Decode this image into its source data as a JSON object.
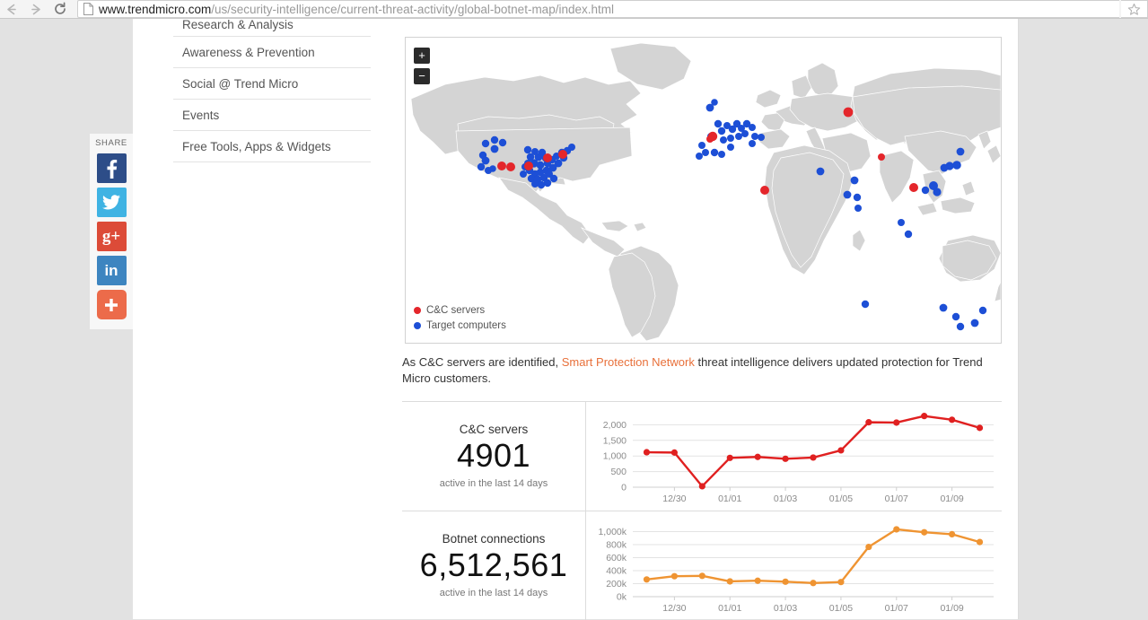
{
  "browser": {
    "back_icon": "back-arrow-icon",
    "forward_icon": "forward-arrow-icon",
    "reload_icon": "reload-icon",
    "page_icon": "page-document-icon",
    "star_icon": "bookmark-star-icon",
    "url_domain": "www.trendmicro.com",
    "url_path": "/us/security-intelligence/current-threat-activity/global-botnet-map/index.html"
  },
  "share": {
    "label": "SHARE",
    "items": [
      {
        "name": "facebook",
        "glyph": "f"
      },
      {
        "name": "twitter",
        "glyph": ""
      },
      {
        "name": "googleplus",
        "glyph": "g+"
      },
      {
        "name": "linkedin",
        "glyph": "in"
      },
      {
        "name": "addthis",
        "glyph": "+"
      }
    ]
  },
  "sidebar": {
    "items": [
      {
        "label": "Research & Analysis"
      },
      {
        "label": "Awareness & Prevention"
      },
      {
        "label": "Social @ Trend Micro"
      },
      {
        "label": "Events"
      },
      {
        "label": "Free Tools, Apps & Widgets"
      }
    ]
  },
  "map": {
    "zoom_in_label": "+",
    "zoom_out_label": "−",
    "legend": [
      {
        "label": "C&C servers",
        "color": "#e4262b"
      },
      {
        "label": "Target computers",
        "color": "#1d4fd6"
      }
    ]
  },
  "caption": {
    "before": "As C&C servers are identified, ",
    "link": "Smart Protection Network",
    "after": " threat intelligence delivers updated protection for Trend Micro customers."
  },
  "panels": [
    {
      "title": "C&C servers",
      "value": "4901",
      "subtitle": "active in the last 14 days"
    },
    {
      "title": "Botnet connections",
      "value": "6,512,561",
      "subtitle": "active in the last 14 days"
    }
  ],
  "chart_data": [
    {
      "type": "line",
      "title": "C&C servers",
      "xlabel": "",
      "ylabel": "",
      "color": "#e02020",
      "x": [
        "12/29",
        "12/30",
        "12/31",
        "01/01",
        "01/02",
        "01/03",
        "01/04",
        "01/05",
        "01/06",
        "01/07",
        "01/08",
        "01/09",
        "01/10"
      ],
      "tick_labels": [
        "12/30",
        "01/01",
        "01/03",
        "01/05",
        "01/07",
        "01/09"
      ],
      "values": [
        1120,
        1110,
        30,
        940,
        970,
        910,
        950,
        1180,
        2080,
        2070,
        2280,
        2160,
        1900
      ],
      "ylim": [
        0,
        2500
      ],
      "yticks": [
        0,
        500,
        1000,
        1500,
        2000
      ],
      "ytick_labels": [
        "0",
        "500",
        "1,000",
        "1,500",
        "2,000"
      ],
      "grid": true,
      "legend": "none"
    },
    {
      "type": "line",
      "title": "Botnet connections",
      "xlabel": "",
      "ylabel": "",
      "color": "#ef9432",
      "x": [
        "12/29",
        "12/30",
        "12/31",
        "01/01",
        "01/02",
        "01/03",
        "01/04",
        "01/05",
        "01/06",
        "01/07",
        "01/08",
        "01/09",
        "01/10"
      ],
      "tick_labels": [
        "12/30",
        "01/01",
        "01/03",
        "01/05",
        "01/07",
        "01/09"
      ],
      "values": [
        265000,
        315000,
        320000,
        235000,
        245000,
        230000,
        210000,
        225000,
        765000,
        1035000,
        990000,
        960000,
        840000
      ],
      "ylim": [
        0,
        1200000
      ],
      "yticks": [
        0,
        200000,
        400000,
        600000,
        800000,
        1000000
      ],
      "ytick_labels": [
        "0k",
        "200k",
        "400k",
        "600k",
        "800k",
        "1,000k"
      ],
      "grid": true,
      "legend": "none"
    }
  ]
}
